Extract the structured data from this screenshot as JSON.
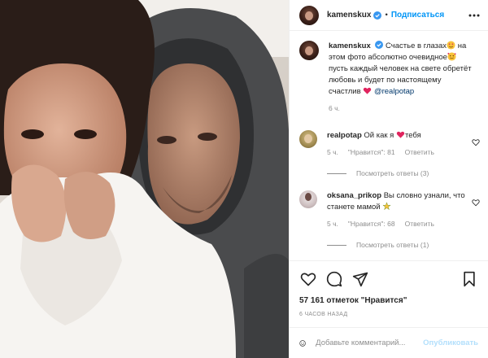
{
  "post": {
    "author": "kamenskux",
    "verified": true,
    "follow_label": "Подписаться",
    "caption": {
      "username": "kamenskux",
      "part1": "Счастье в глазах",
      "part2": "на этом фото абсолютно очевидное",
      "part3": "пусть каждый человек на свете обретёт любовь и будет по настоящему счастлив",
      "mention": "@realpotap",
      "time": "6 ч."
    }
  },
  "comments": [
    {
      "username": "realpotap",
      "text_before": "Ой как я ",
      "text_after": "тебя",
      "time": "5 ч.",
      "likes": "\"Нравится\": 81",
      "reply": "Ответить",
      "view_replies": "Посмотреть ответы (3)"
    },
    {
      "username": "oksana_prikop",
      "text": "Вы словно узнали, что станете мамой",
      "time": "5 ч.",
      "likes": "\"Нравится\": 68",
      "reply": "Ответить",
      "view_replies": "Посмотреть ответы (1)"
    }
  ],
  "likes_count": "57 161 отметок \"Нравится\"",
  "posted_ago": "6 ЧАСОВ НАЗАД",
  "add_comment": {
    "placeholder": "Добавьте комментарий...",
    "publish_label": "Опубликовать"
  },
  "icons": [
    "more-icon",
    "heart-icon",
    "comment-icon",
    "share-icon",
    "bookmark-icon",
    "smile-icon",
    "verified-icon"
  ],
  "colors": {
    "accent": "#0095f6",
    "heart": "#ed4956",
    "muted": "#8e8e8e",
    "publish_disabled": "#b2dffc"
  }
}
